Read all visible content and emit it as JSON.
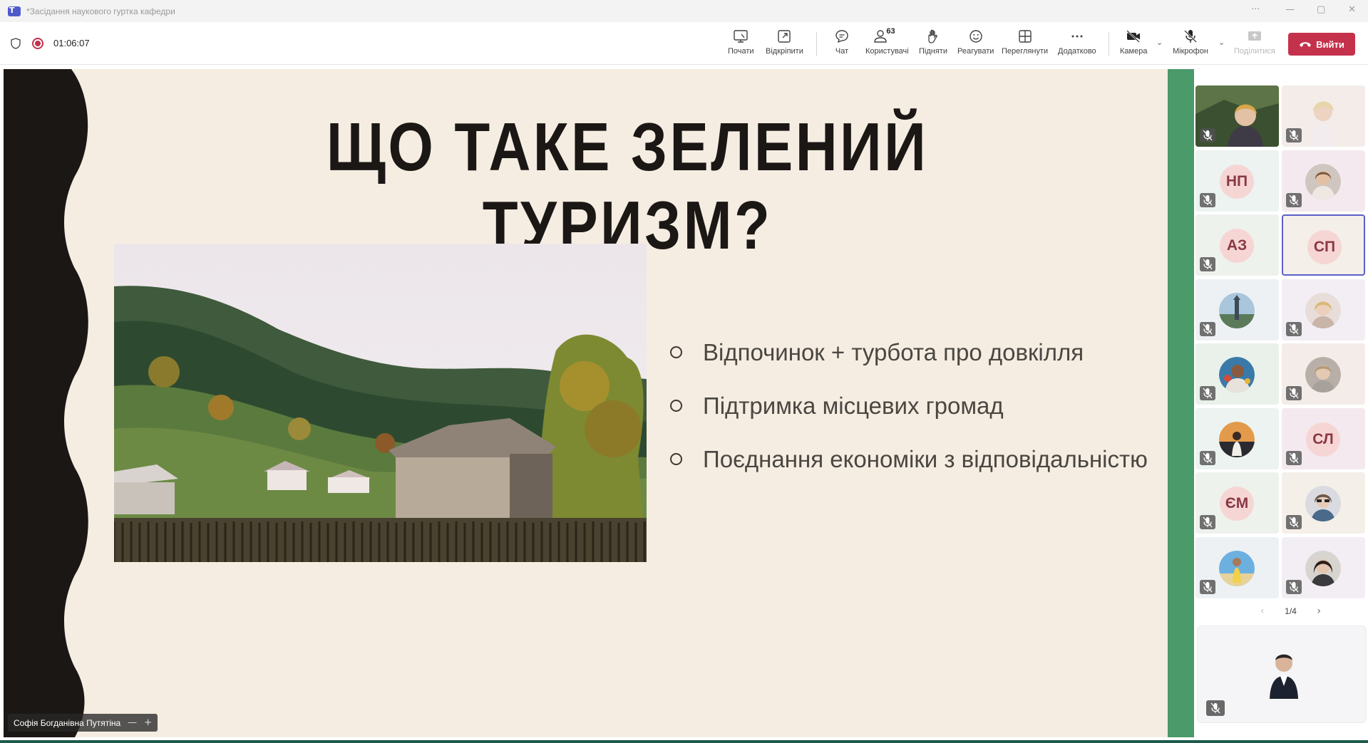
{
  "window": {
    "title": "*Засідання наукового гуртка кафедри",
    "controls": [
      "···",
      "—",
      "▢",
      "✕"
    ]
  },
  "toolbar": {
    "timer": "01:06:07",
    "buttons": {
      "start": "Почати",
      "unpin": "Відкріпити",
      "chat": "Чат",
      "people": "Користувачі",
      "people_count": "63",
      "raise": "Підняти",
      "react": "Реагувати",
      "view": "Переглянути",
      "more": "Додатково",
      "camera": "Камера",
      "mic": "Мікрофон",
      "share": "Поділитися"
    },
    "leave": "Вийти",
    "colors": {
      "leave": "#c4314b",
      "record": "#c4314b"
    }
  },
  "slide": {
    "title": "ЩО ТАКЕ ЗЕЛЕНИЙ ТУРИЗМ?",
    "bullets": [
      "Відпочинок + турбота про довкілля",
      "Підтримка місцевих громад",
      "Поєднання економіки з відповідальністю"
    ],
    "colors": {
      "background": "#f5ede1",
      "wave": "#1b1715",
      "accent_bar": "#4a9a6a"
    }
  },
  "presenter": {
    "name": "Софія Богданівна Путятіна",
    "controls": [
      "—",
      "+"
    ]
  },
  "participants": [
    {
      "type": "video",
      "scene": "landscape-woman",
      "muted": true
    },
    {
      "type": "video",
      "scene": "blonde-woman",
      "muted": true
    },
    {
      "type": "initials",
      "initials": "НП",
      "muted": true
    },
    {
      "type": "video",
      "scene": "woman",
      "muted": true
    },
    {
      "type": "initials",
      "initials": "АЗ",
      "muted": true
    },
    {
      "type": "initials",
      "initials": "СП",
      "muted": false,
      "active": true
    },
    {
      "type": "video",
      "scene": "tower",
      "muted": true
    },
    {
      "type": "video",
      "scene": "blonde-woman-2",
      "muted": true
    },
    {
      "type": "video",
      "scene": "colorful",
      "muted": true
    },
    {
      "type": "video",
      "scene": "woman-sunglasses",
      "muted": true
    },
    {
      "type": "video",
      "scene": "sunset",
      "muted": true
    },
    {
      "type": "initials",
      "initials": "СЛ",
      "muted": true
    },
    {
      "type": "initials",
      "initials": "ЄМ",
      "muted": true
    },
    {
      "type": "video",
      "scene": "woman-glasses",
      "muted": true
    },
    {
      "type": "video",
      "scene": "beach",
      "muted": true
    },
    {
      "type": "video",
      "scene": "dark-hair-woman",
      "muted": true
    }
  ],
  "pager": {
    "label": "1/4"
  },
  "self_view": {
    "muted": true
  }
}
